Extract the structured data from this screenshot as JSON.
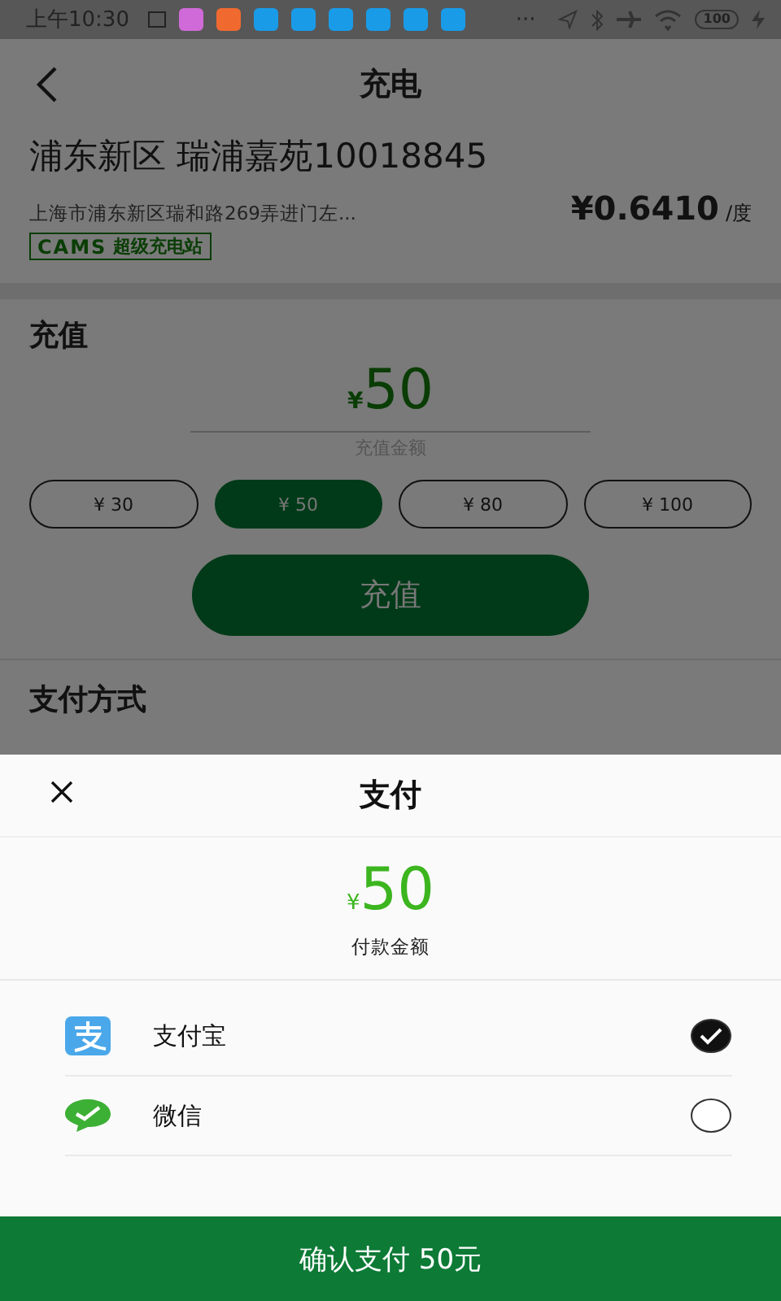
{
  "status_bar": {
    "time": "上午10:30",
    "overflow": "···",
    "battery": "100"
  },
  "header": {
    "title": "充电"
  },
  "station": {
    "name": "浦东新区 瑞浦嘉苑10018845",
    "address": "上海市浦东新区瑞和路269弄进门左...",
    "price": "¥0.6410",
    "unit": "/度",
    "tag": {
      "logo": "CAMS",
      "label": "超级充电站"
    }
  },
  "recharge": {
    "title": "充值",
    "currency": "¥",
    "amount": "50",
    "amount_label": "充值金额",
    "options": [
      {
        "label": "¥ 30",
        "selected": false
      },
      {
        "label": "¥ 50",
        "selected": true
      },
      {
        "label": "¥ 80",
        "selected": false
      },
      {
        "label": "¥ 100",
        "selected": false
      }
    ],
    "button": "充值"
  },
  "payment": {
    "title": "支付方式"
  },
  "sheet": {
    "title": "支付",
    "currency": "¥",
    "amount": "50",
    "amount_label": "付款金额",
    "methods": [
      {
        "kind": "alipay",
        "name": "支付宝",
        "selected": true
      },
      {
        "kind": "wechat",
        "name": "微信",
        "selected": false
      }
    ],
    "confirm": "确认支付 50元"
  }
}
